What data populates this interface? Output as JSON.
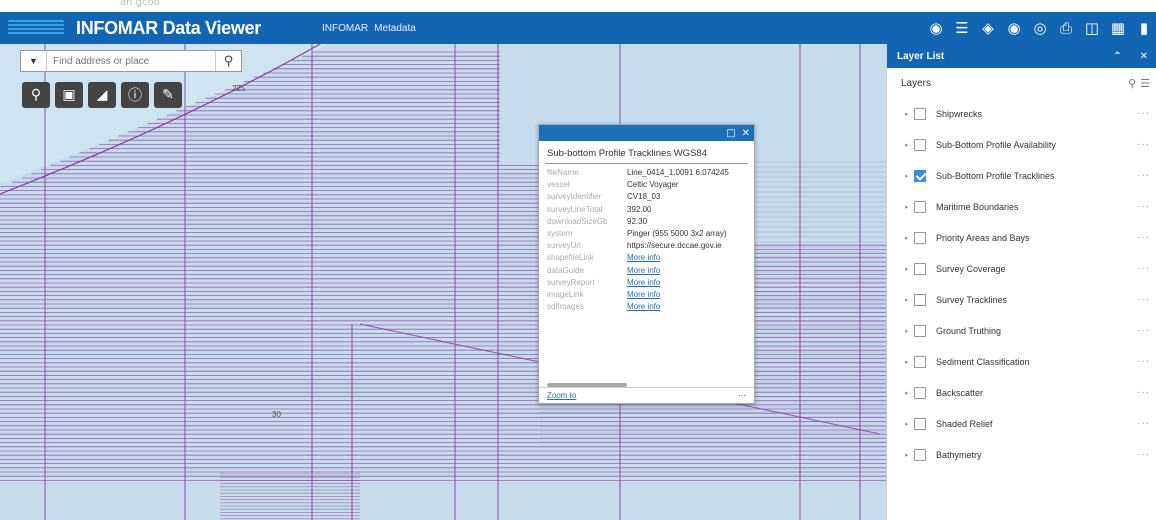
{
  "topbar": {
    "text": "an gcoo"
  },
  "header": {
    "title": "INFOMAR Data Viewer",
    "links": [
      "INFOMAR",
      "Metadata"
    ],
    "tool_icons": [
      "basemap-icon",
      "legend-icon",
      "layers-icon",
      "stack-icon",
      "measure-icon",
      "print-icon",
      "save-icon",
      "grid-icon",
      "more-icon"
    ]
  },
  "search": {
    "placeholder": "Find address or place"
  },
  "map": {
    "label_top": "225",
    "label_bottom": "30"
  },
  "popup": {
    "title": "Sub-bottom Profile Tracklines WGS84",
    "rows": [
      {
        "key": "fileName",
        "value": "Line_0414_1.0091 6.074245",
        "link": false
      },
      {
        "key": "vessel",
        "value": "Celtic Voyager",
        "link": false
      },
      {
        "key": "surveyIdentifier",
        "value": "CV18_03",
        "link": false
      },
      {
        "key": "surveyLineTotal",
        "value": "392.00",
        "link": false
      },
      {
        "key": "downloadSizeGb",
        "value": "92.30",
        "link": false
      },
      {
        "key": "system",
        "value": "Pinger (955 5000 3x2 array)",
        "link": false
      },
      {
        "key": "surveyUrl",
        "value": "https://secure.dccae.gov.ie",
        "link": false
      },
      {
        "key": "shapefileLink",
        "value": "More info",
        "link": true
      },
      {
        "key": "dataGuide",
        "value": "More info",
        "link": true
      },
      {
        "key": "surveyReport",
        "value": "More info",
        "link": true
      },
      {
        "key": "imageLink",
        "value": "More info",
        "link": true
      },
      {
        "key": "sdfImages",
        "value": "More info",
        "link": true
      }
    ],
    "zoom_label": "Zoom to",
    "more_label": "···"
  },
  "panel": {
    "title": "Layer List",
    "layers_label": "Layers",
    "layers": [
      {
        "name": "Shipwrecks",
        "checked": false
      },
      {
        "name": "Sub-Bottom Profile Availability",
        "checked": false
      },
      {
        "name": "Sub-Bottom Profile Tracklines",
        "checked": true
      },
      {
        "name": "Maritime Boundaries",
        "checked": false
      },
      {
        "name": "Priority Areas and Bays",
        "checked": false
      },
      {
        "name": "Survey Coverage",
        "checked": false
      },
      {
        "name": "Survey Tracklines",
        "checked": false
      },
      {
        "name": "Ground Truthing",
        "checked": false
      },
      {
        "name": "Sediment Classification",
        "checked": false
      },
      {
        "name": "Backscatter",
        "checked": false
      },
      {
        "name": "Shaded Relief",
        "checked": false
      },
      {
        "name": "Bathymetry",
        "checked": false
      }
    ],
    "more_label": "···"
  },
  "colors": {
    "header": "#1464b4",
    "map_bg": "#cfe3f0",
    "track_line": "#8a3aa0",
    "accent": "#3b8ed6"
  }
}
